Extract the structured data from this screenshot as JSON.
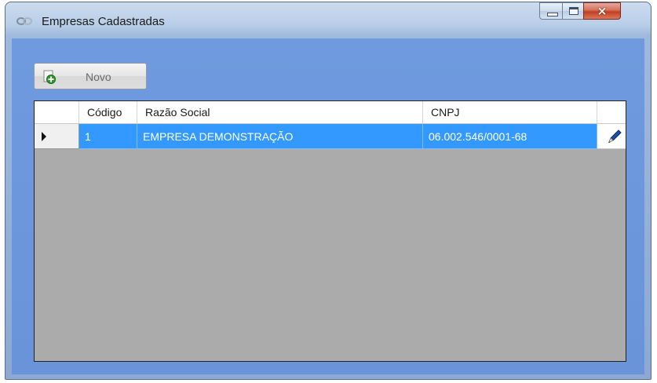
{
  "window": {
    "title": "Empresas Cadastradas",
    "icon": "chain-link-icon",
    "controls": {
      "minimize": "minimize-icon",
      "maximize": "maximize-icon",
      "close": "×"
    }
  },
  "toolbar": {
    "novo_label": "Novo",
    "novo_icon": "add-document-icon"
  },
  "grid": {
    "columns": [
      "Código",
      "Razão Social",
      "CNPJ"
    ],
    "rows": [
      {
        "codigo": "1",
        "razao_social": "EMPRESA DEMONSTRAÇÃO",
        "cnpj": "06.002.546/0001-68",
        "action_icon": "pencil-edit-icon",
        "selected": true
      }
    ]
  },
  "colors": {
    "selection": "#3399ff",
    "grid_background": "#ababab",
    "client_background": "#6f9adf"
  }
}
